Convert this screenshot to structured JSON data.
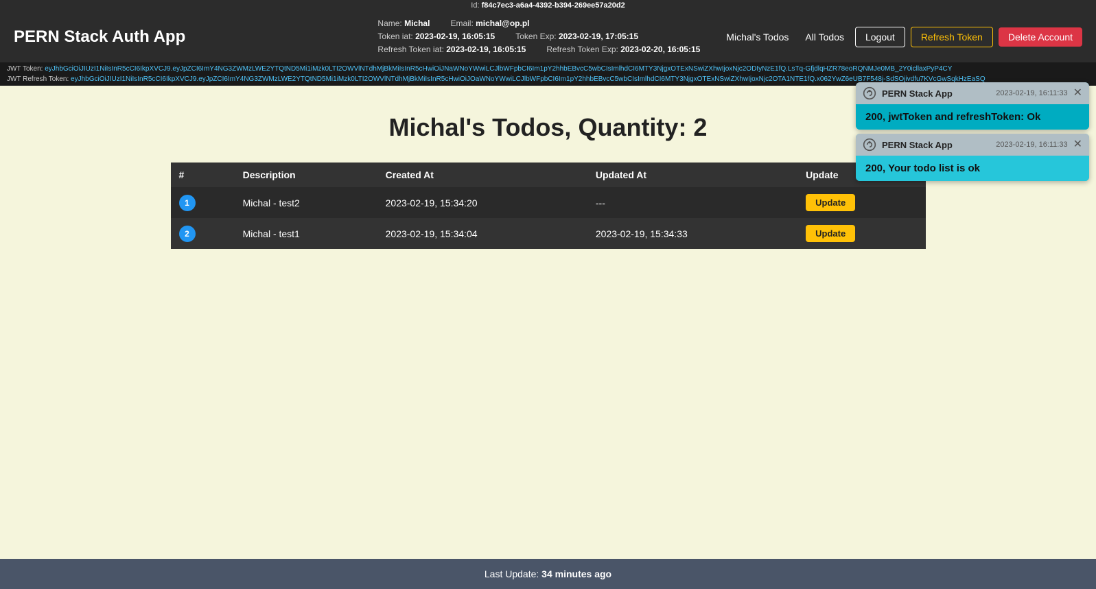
{
  "id_bar": {
    "label": "Id:",
    "value": "f84c7ec3-a6a4-4392-b394-269ee57a20d2"
  },
  "navbar": {
    "brand": "PERN Stack Auth App",
    "info": {
      "name_label": "Name:",
      "name_value": "Michal",
      "email_label": "Email:",
      "email_value": "michal@op.pl",
      "token_iat_label": "Token iat:",
      "token_iat_value": "2023-02-19, 16:05:15",
      "token_exp_label": "Token Exp:",
      "token_exp_value": "2023-02-19, 17:05:15",
      "refresh_token_iat_label": "Refresh Token iat:",
      "refresh_token_iat_value": "2023-02-19, 16:05:15",
      "refresh_token_exp_label": "Refresh Token Exp:",
      "refresh_token_exp_value": "2023-02-20, 16:05:15"
    },
    "nav": {
      "michals_todos": "Michal's Todos",
      "all_todos": "All Todos",
      "logout": "Logout",
      "refresh_token": "Refresh Token",
      "delete_account": "Delete Account"
    }
  },
  "token_bar": {
    "jwt_label": "JWT Token:",
    "jwt_value": "eyJhbGciOiJIUzI1NiIsInR5cCI6IkpXVCJ9.eyJpZCI6ImY4NG3ZWMzLWE2YTQtND5Mi1iMzk0LTI2OWVlNTdhMjBkMiIsInR5cHwiOiJNaWNoYWwiLCJlbWFpbCI6Im1pY2hhbEBvcC5wbCIsImlhdCI6MTY3NjgxOTExNSwiZXhwIjoxNjc2ODIyNzE1fQ.LsTq-GfjdlqHZR78eoRQNMJe0MB_2Y0icllaxPyP4CY",
    "jwt_refresh_label": "JWT Refresh Token:",
    "jwt_refresh_value": "eyJhbGciOiJIUzI1NiIsInR5cCI6IkpXVCJ9.eyJpZCI6ImY4NG3ZWMzLWE2YTQtND5Mi1iMzk0LTI2OWVlNTdhMjBkMiIsInR5cHwiOiJOaWNoYWwiLCJlbWFpbCI6Im1pY2hhbEBvcC5wbCIsImlhdCI6MTY3NjgxOTExNSwiZXhwIjoxNjc2OTA1NTE1fQ.x062YwZ6eUB7F548j-SdSOjivdfu7KVcGwSqkHzEaSQ"
  },
  "main": {
    "title": "Michal's Todos, Quantity: 2",
    "table": {
      "headers": [
        "#",
        "Description",
        "Created At",
        "Updated At",
        "Update"
      ],
      "rows": [
        {
          "num": "1",
          "description": "Michal - test2",
          "created_at": "2023-02-19, 15:34:20",
          "updated_at": "---",
          "update_label": "Update"
        },
        {
          "num": "2",
          "description": "Michal - test1",
          "created_at": "2023-02-19, 15:34:04",
          "updated_at": "2023-02-19, 15:34:33",
          "update_label": "Update"
        }
      ]
    }
  },
  "footer": {
    "label": "Last Update:",
    "value": "34 minutes ago"
  },
  "toasts": [
    {
      "app_name": "PERN Stack App",
      "time": "2023-02-19, 16:11:33",
      "message": "200, jwtToken and refreshToken: Ok"
    },
    {
      "app_name": "PERN Stack App",
      "time": "2023-02-19, 16:11:33",
      "message": "200, Your todo list is ok"
    }
  ]
}
